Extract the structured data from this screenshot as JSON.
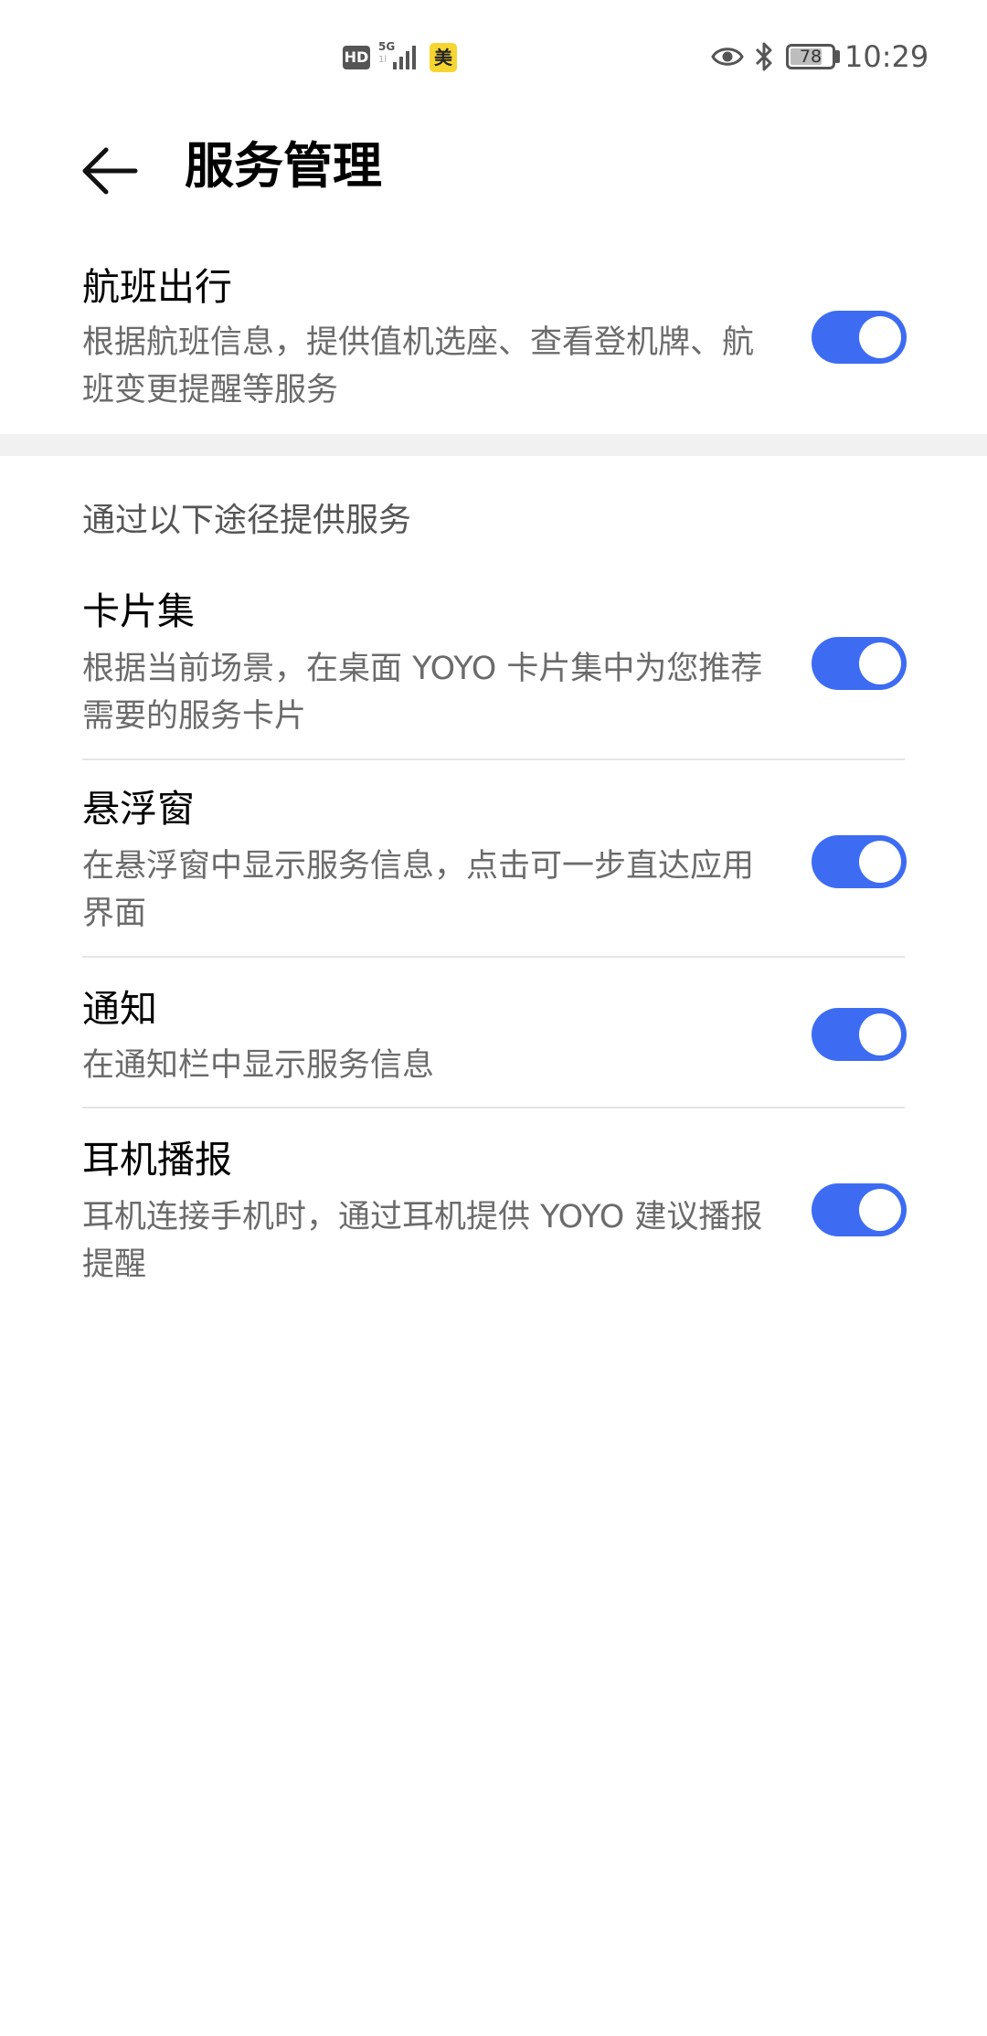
{
  "status_bar": {
    "hd_label": "HD",
    "network_label": "5G",
    "network_sub": "1l",
    "app_badge": "美",
    "battery": "78",
    "battery_level": 0.78,
    "time": "10:29"
  },
  "header": {
    "title": "服务管理"
  },
  "main_service": {
    "title": "航班出行",
    "description": "根据航班信息，提供值机选座、查看登机牌、航班变更提醒等服务",
    "enabled": true
  },
  "channels": {
    "section_label": "通过以下途径提供服务",
    "items": [
      {
        "title": "卡片集",
        "description": "根据当前场景，在桌面 YOYO 卡片集中为您推荐需要的服务卡片",
        "enabled": true
      },
      {
        "title": "悬浮窗",
        "description": "在悬浮窗中显示服务信息，点击可一步直达应用界面",
        "enabled": true
      },
      {
        "title": "通知",
        "description": "在通知栏中显示服务信息",
        "enabled": true
      },
      {
        "title": "耳机播报",
        "description": "耳机连接手机时，通过耳机提供 YOYO 建议播报提醒",
        "enabled": true
      }
    ]
  },
  "colors": {
    "toggle_on": "#3d6cf3",
    "description_text": "#6b6b6b",
    "section_band": "#f1f1f1"
  },
  "icons": {
    "back": "arrow-left-icon",
    "eye": "eye-icon",
    "bluetooth": "bluetooth-icon",
    "signal": "signal-icon",
    "battery": "battery-icon"
  }
}
